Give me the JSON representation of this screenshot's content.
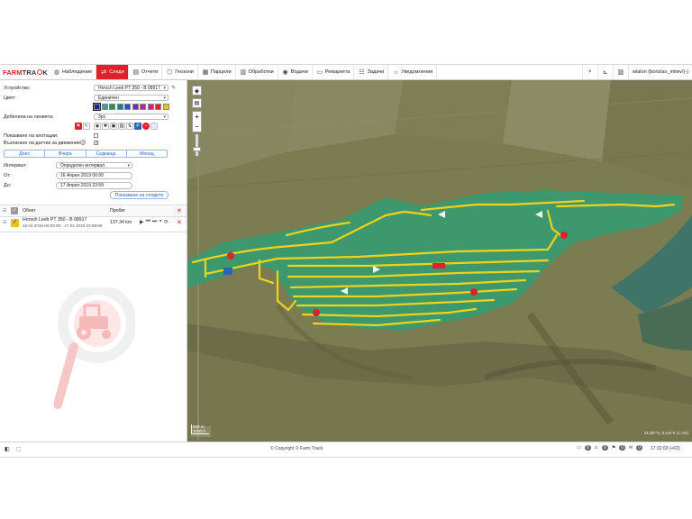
{
  "brand": {
    "farm": "FARM",
    "track_a": "TRA",
    "track_b": "K"
  },
  "nav": {
    "items": [
      {
        "label": "Наблюдение",
        "icon": "globe-icon",
        "glyph": "◍"
      },
      {
        "label": "Следи",
        "icon": "route-icon",
        "glyph": "⇄",
        "active": true
      },
      {
        "label": "Отчети",
        "icon": "report-icon",
        "glyph": "▤"
      },
      {
        "label": "Геозони",
        "icon": "geozone-icon",
        "glyph": "⬡"
      },
      {
        "label": "Парцели",
        "icon": "parcel-icon",
        "glyph": "▦"
      },
      {
        "label": "Обработки",
        "icon": "processing-icon",
        "glyph": "▥"
      },
      {
        "label": "Водачи",
        "icon": "driver-icon",
        "glyph": "◉"
      },
      {
        "label": "Ремаркета",
        "icon": "trailer-icon",
        "glyph": "▭"
      },
      {
        "label": "Задачи",
        "icon": "tasks-icon",
        "glyph": "☷"
      },
      {
        "label": "Уведомления",
        "icon": "notifications-icon",
        "glyph": "☼"
      }
    ],
    "user": "wialon (borislav_mitev/)-)"
  },
  "form": {
    "device_label": "Устройство:",
    "device_value": "Horsch Leeb PT 350 - В 08917",
    "color_label": "Цвят:",
    "color_value": "Единичен",
    "colors": [
      "#1a2d8f",
      "#3aa0a0",
      "#2c8f4a",
      "#1f7a9e",
      "#2b4fc4",
      "#6a2bbd",
      "#b5269a",
      "#d81f7e",
      "#e0202a",
      "#e7c22b"
    ],
    "width_label": "Дебелина на линията:",
    "width_value": "3px",
    "annotations_label": "Показване на анотации:",
    "sensors_label": "Възлагане на датчик за движение:"
  },
  "periods": [
    "Днес",
    "Вчера",
    "Седмица",
    "Месец"
  ],
  "interval": {
    "label": "Интервал:",
    "value": "Определен интервал",
    "from_label": "От:",
    "from_value": "16 Април 2019 00:00",
    "to_label": "До:",
    "to_value": "17 Април 2019 23:59",
    "show_button": "Показване на следите"
  },
  "table": {
    "col_object": "Обект",
    "col_mileage": "Пробег",
    "rows": [
      {
        "name": "Horsch Leeb PT 350 - В 08917",
        "period": "16.04.2019 00:00:00 - 17.04.2019 23:59:59",
        "mileage": "137.34 km"
      }
    ]
  },
  "map": {
    "scale_top": "500 m",
    "scale_bottom": "2000 ft",
    "coords": "43.387°N, 8.446°E (1.724)",
    "markers": [
      "1.3",
      "4.7"
    ],
    "field_color": "#3a9a70",
    "track_color": "#f0d21a"
  },
  "footer": {
    "copyright": "© Copyright © Farm Track",
    "time": "17:32:03 (+02)",
    "counters": [
      "0",
      "0",
      "0",
      "0"
    ]
  }
}
